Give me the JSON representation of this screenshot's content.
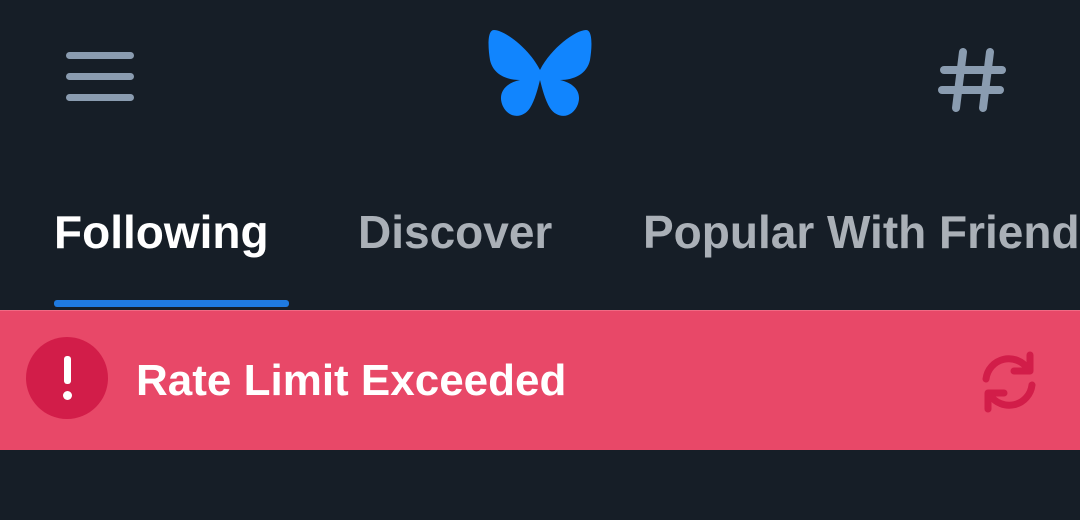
{
  "header": {
    "menu_icon": "hamburger-menu-icon",
    "logo": "butterfly-logo",
    "feeds_icon": "hashtag-icon"
  },
  "tabs": [
    {
      "label": "Following",
      "active": true
    },
    {
      "label": "Discover",
      "active": false
    },
    {
      "label": "Popular With Friends",
      "active": false
    }
  ],
  "banner": {
    "icon": "exclamation-circle-icon",
    "message": "Rate Limit Exceeded",
    "retry_icon": "refresh-icon"
  },
  "colors": {
    "background": "#161e27",
    "accent": "#1f7ae0",
    "logo": "#1185fe",
    "banner": "#e84868",
    "banner_icon": "#d21d49"
  }
}
